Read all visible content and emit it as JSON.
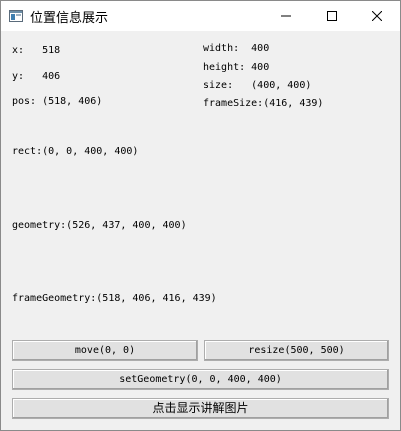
{
  "window": {
    "title": "位置信息展示"
  },
  "info": {
    "x": "x:   518",
    "y": "y:   406",
    "pos": "pos: (518, 406)",
    "width": "width:  400",
    "height": "height: 400",
    "size": "size:   (400, 400)",
    "frameSize": "frameSize:(416, 439)",
    "rect": "rect:(0, 0, 400, 400)",
    "geometry": "geometry:(526, 437, 400, 400)",
    "frameGeometry": "frameGeometry:(518, 406, 416, 439)"
  },
  "buttons": {
    "move": "move(0, 0)",
    "resize": "resize(500, 500)",
    "setGeometry": "setGeometry(0, 0, 400, 400)",
    "explain": "点击显示讲解图片"
  },
  "icons": {
    "app": "app-window-icon",
    "minimize": "minimize-icon",
    "maximize": "maximize-icon",
    "close": "close-icon"
  }
}
